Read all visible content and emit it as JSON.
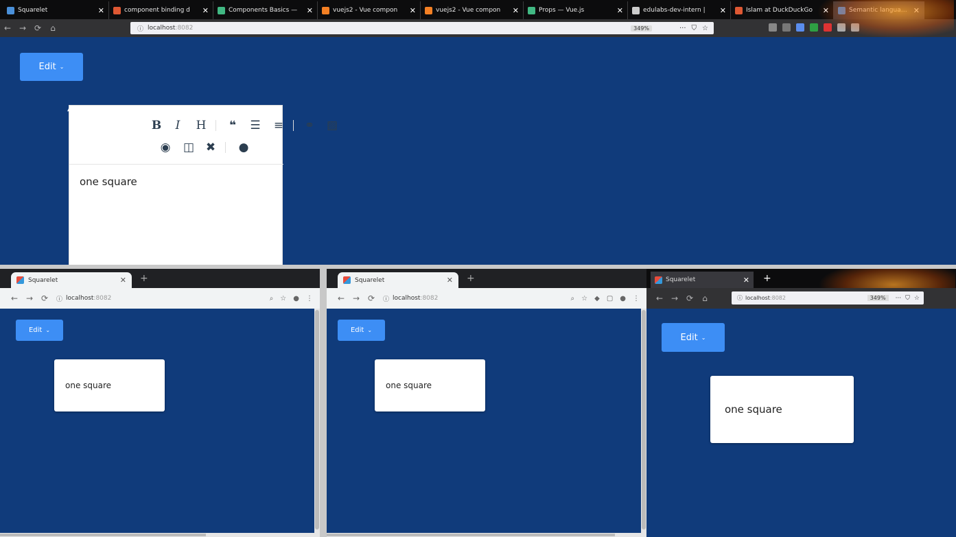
{
  "top_browser": {
    "tabs": [
      {
        "title": "Squarelet",
        "icon_color": "#4a90d9"
      },
      {
        "title": "component binding d",
        "icon_color": "#de5833"
      },
      {
        "title": "Components Basics —",
        "icon_color": "#41b883"
      },
      {
        "title": "vuejs2 - Vue compon",
        "icon_color": "#f48024"
      },
      {
        "title": "vuejs2 - Vue compon",
        "icon_color": "#f48024"
      },
      {
        "title": "Props — Vue.js",
        "icon_color": "#41b883"
      },
      {
        "title": "edulabs-dev-intern |",
        "icon_color": "#cccccc"
      },
      {
        "title": "Islam at DuckDuckGo",
        "icon_color": "#de5833"
      },
      {
        "title": "Semantic language pa",
        "icon_color": "#4a90d9"
      }
    ],
    "url_host": "localhost",
    "url_port": ":8082",
    "zoom": "349%"
  },
  "top_app": {
    "edit_label": "Edit",
    "editor_content": "one square",
    "toolbar_icons": [
      "bold-icon",
      "italic-icon",
      "heading-icon",
      "quote-icon",
      "unordered-list-icon",
      "ordered-list-icon",
      "link-icon",
      "image-icon",
      "preview-icon",
      "side-by-side-icon",
      "fullscreen-icon",
      "guide-icon"
    ]
  },
  "window_a": {
    "tab_title": "Squarelet",
    "url_host": "localhost",
    "url_port": ":8082",
    "edit_label": "Edit",
    "card_text": "one square"
  },
  "window_b": {
    "tab_title": "Squarelet",
    "url_host": "localhost",
    "url_port": ":8082",
    "edit_label": "Edit",
    "card_text": "one square"
  },
  "window_c": {
    "tab_title": "Squarelet",
    "url_host": "localhost",
    "url_port": ":8082",
    "zoom": "349%",
    "edit_label": "Edit",
    "card_text": "one square"
  },
  "colors": {
    "app_background": "#103b7b",
    "edit_button": "#3d8ef5",
    "firefox_tabbar": "#0c0c0d",
    "chrome_tabstrip": "#202124"
  }
}
